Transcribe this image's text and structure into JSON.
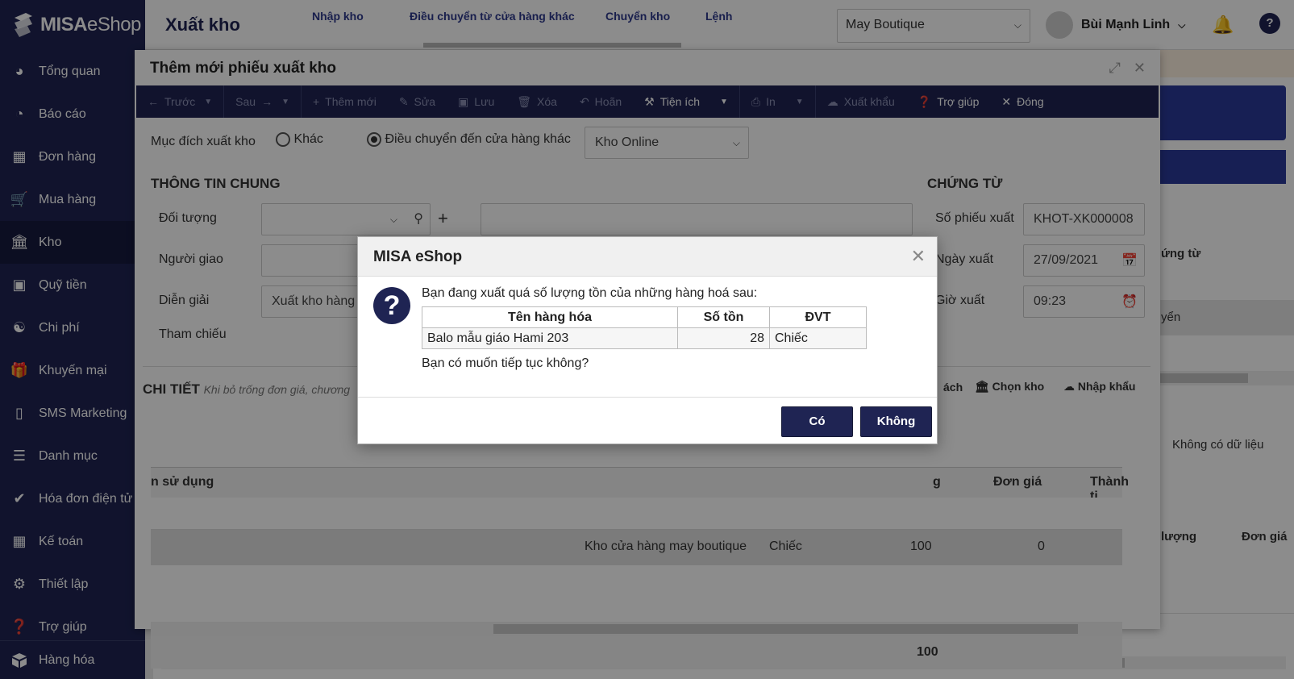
{
  "app": {
    "brand_bold": "MISA",
    "brand_thin": "eShop",
    "page_title": "Xuất kho",
    "top_tabs": [
      "Nhập kho",
      "Điều chuyển từ cửa hàng khác",
      "Chuyển kho",
      "Lệnh"
    ],
    "store": "May Boutique",
    "user": "Bùi Mạnh Linh"
  },
  "sidebar": {
    "items": [
      {
        "label": "Tổng quan",
        "icon": "dashboard-icon"
      },
      {
        "label": "Báo cáo",
        "icon": "pie-chart-icon"
      },
      {
        "label": "Đơn hàng",
        "icon": "order-icon"
      },
      {
        "label": "Mua hàng",
        "icon": "cart-icon"
      },
      {
        "label": "Kho",
        "icon": "warehouse-icon"
      },
      {
        "label": "Quỹ tiền",
        "icon": "cash-icon"
      },
      {
        "label": "Chi phí",
        "icon": "expense-icon"
      },
      {
        "label": "Khuyến mại",
        "icon": "gift-icon"
      },
      {
        "label": "SMS Marketing",
        "icon": "phone-icon"
      },
      {
        "label": "Danh mục",
        "icon": "list-icon"
      },
      {
        "label": "Hóa đơn điện tử",
        "icon": "invoice-icon"
      },
      {
        "label": "Kế toán",
        "icon": "calculator-icon"
      },
      {
        "label": "Thiết lập",
        "icon": "gear-icon"
      },
      {
        "label": "Trợ giúp",
        "icon": "help-icon"
      }
    ],
    "bottom": "Hàng hóa",
    "active_index": 4
  },
  "form": {
    "title": "Thêm mới phiếu xuất kho",
    "toolbar": {
      "prev": "Trước",
      "next": "Sau",
      "add": "Thêm mới",
      "edit": "Sửa",
      "save": "Lưu",
      "delete": "Xóa",
      "undo": "Hoãn",
      "utility": "Tiện ích",
      "print": "In",
      "export": "Xuất khẩu",
      "help": "Trợ giúp",
      "close": "Đóng"
    },
    "purpose_label": "Mục đích xuất kho",
    "purpose_other": "Khác",
    "purpose_transfer": "Điều chuyển đến cửa hàng khác",
    "target_store": "Kho Online",
    "general_section": "THÔNG TIN CHUNG",
    "doc_section": "CHỨNG TỪ",
    "object_label": "Đối tượng",
    "deliverer_label": "Người giao",
    "description_label": "Diễn giải",
    "description_value": "Xuất kho hàng",
    "reference_label": "Tham chiếu",
    "doc_no_label": "Số phiếu xuất",
    "doc_no_value": "KHOT-XK000008",
    "date_label": "Ngày xuất",
    "date_value": "27/09/2021",
    "time_label": "Giờ xuất",
    "time_value": "09:23",
    "detail_title": "CHI TIẾT",
    "detail_hint": "Khi bỏ trống đơn giá, chương",
    "detail_actions": [
      "ách",
      "Chọn kho",
      "Nhập khẩu"
    ],
    "grid_headers": [
      "n sử dụng",
      "g",
      "Đơn giá",
      "Thành ti"
    ],
    "row": {
      "warehouse": "Kho cửa hàng may boutique",
      "unit": "Chiếc",
      "qty": "100",
      "price": "0"
    },
    "footer_total": "100"
  },
  "background": {
    "right_col_header": "ứng từ",
    "right_row_text": "yển",
    "no_data": "Không có dữ liệu",
    "bottom_headers": [
      "lượng",
      "Đơn giá"
    ]
  },
  "message": {
    "title": "MISA eShop",
    "text": "Bạn đang xuất quá số lượng tồn của những hàng hoá sau:",
    "columns": [
      "Tên hàng hóa",
      "Số tồn",
      "ĐVT"
    ],
    "rows": [
      {
        "name": "Balo mẫu giáo Hami 203",
        "stock": "28",
        "unit": "Chiếc"
      }
    ],
    "question": "Bạn có muốn tiếp tục không?",
    "yes": "Có",
    "no": "Không"
  }
}
